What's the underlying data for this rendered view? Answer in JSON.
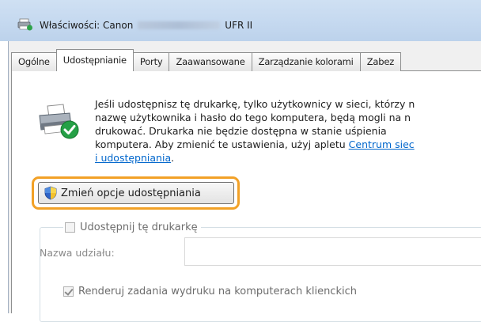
{
  "window": {
    "title_prefix": "Właściwości: Canon",
    "title_suffix": "UFR II"
  },
  "tabs": [
    {
      "label": "Ogólne",
      "active": false
    },
    {
      "label": "Udostępnianie",
      "active": true
    },
    {
      "label": "Porty",
      "active": false
    },
    {
      "label": "Zaawansowane",
      "active": false
    },
    {
      "label": "Zarządzanie kolorami",
      "active": false
    },
    {
      "label": "Zabez",
      "active": false
    }
  ],
  "description": {
    "line1": "Jeśli udostępnisz tę drukarkę, tylko użytkownicy w sieci, którzy n",
    "line2": "nazwę użytkownika i hasło do tego komputera, będą mogli na n",
    "line3": "drukować. Drukarka nie będzie dostępna w stanie uśpienia",
    "line4_text": "komputera. Aby zmienić te ustawienia, użyj apletu ",
    "line4_link": "Centrum siec",
    "line5_link": "i udostępniania",
    "line5_tail": "."
  },
  "change_button": {
    "label": "Zmień opcje udostępniania"
  },
  "sharing": {
    "share_checkbox_label": "Udostępnij tę drukarkę",
    "share_checked": false,
    "share_name_label": "Nazwa udziału:",
    "share_name_value": "",
    "render_checkbox_label": "Renderuj zadania wydruku na komputerach klienckich",
    "render_checked": true
  },
  "colors": {
    "highlight": "#f2a127",
    "link": "#0066cc",
    "disabled_text": "#6d6d6d"
  }
}
